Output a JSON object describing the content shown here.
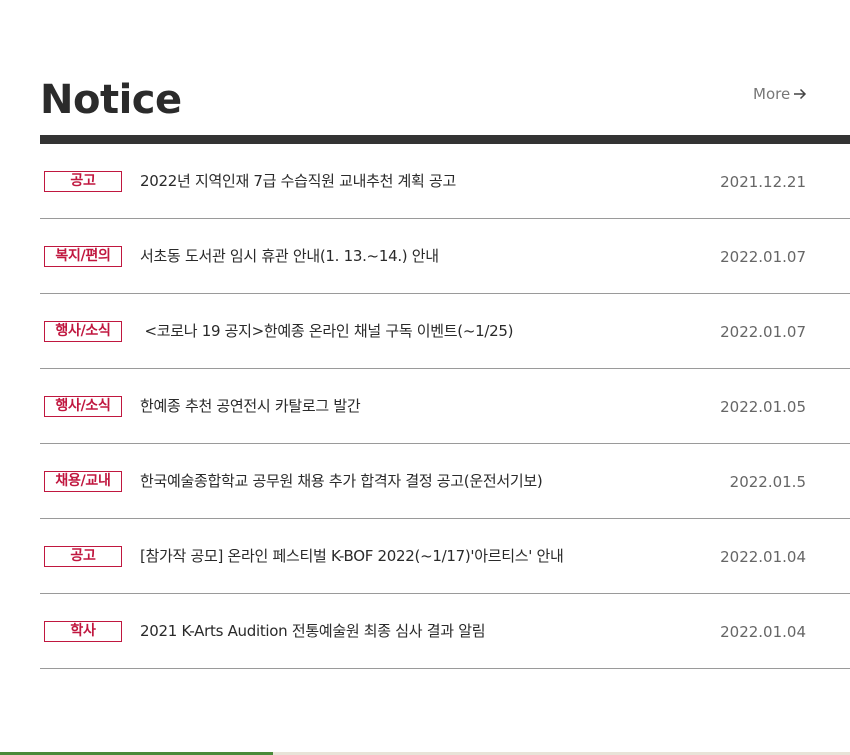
{
  "header": {
    "title": "Notice",
    "more_label": "More",
    "more_icon": "arrow-right-icon"
  },
  "notices": [
    {
      "category": "공고",
      "subject": "2022년 지역인재 7급 수습직원 교내추천 계획 공고",
      "date": "2021.12.21"
    },
    {
      "category": "복지/편의",
      "subject": "서초동 도서관 임시 휴관 안내(1. 13.~14.) 안내",
      "date": "2022.01.07"
    },
    {
      "category": "행사/소식",
      "subject": " <코로나 19 공지>한예종 온라인 채널 구독 이벤트(~1/25)",
      "date": "2022.01.07"
    },
    {
      "category": "행사/소식",
      "subject": "한예종 추천 공연전시 카탈로그 발간",
      "date": "2022.01.05"
    },
    {
      "category": "채용/교내",
      "subject": "한국예술종합학교 공무원 채용 추가 합격자 결정 공고(운전서기보)",
      "date": "2022.01.5"
    },
    {
      "category": "공고",
      "subject": "[참가작 공모] 온라인 페스티벌 K-BOF 2022(~1/17)'아르티스' 안내",
      "date": "2022.01.04"
    },
    {
      "category": "학사",
      "subject": "2021 K-Arts Audition 전통예술원 최종 심사 결과 알림",
      "date": "2022.01.04"
    }
  ],
  "colors": {
    "accent": "#c0173f",
    "rule": "#333333"
  }
}
